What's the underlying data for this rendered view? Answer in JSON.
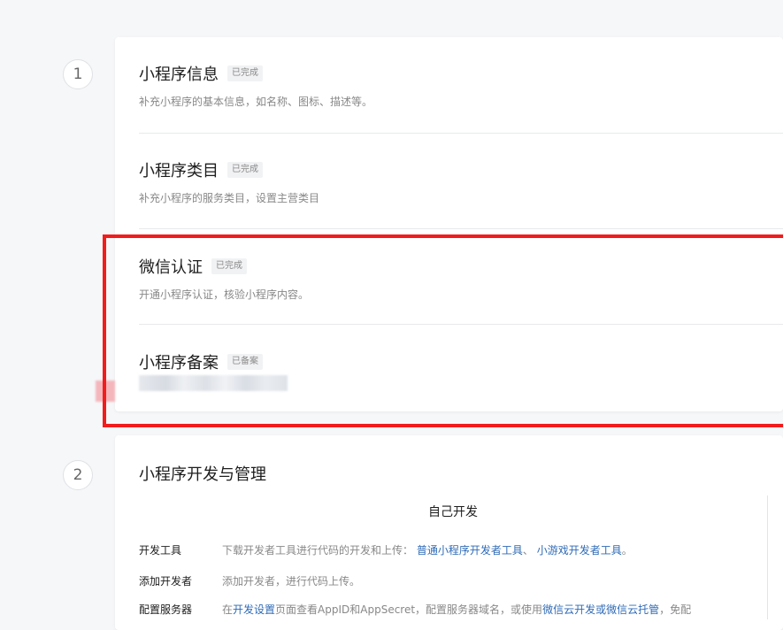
{
  "steps": [
    {
      "number": "1"
    },
    {
      "number": "2",
      "title": "小程序开发与管理"
    }
  ],
  "items": [
    {
      "title": "小程序信息",
      "badge": "已完成",
      "desc": "补充小程序的基本信息，如名称、图标、描述等。"
    },
    {
      "title": "小程序类目",
      "badge": "已完成",
      "desc": "补充小程序的服务类目，设置主营类目"
    },
    {
      "title": "微信认证",
      "badge": "已完成",
      "desc": "开通小程序认证，核验小程序内容。"
    },
    {
      "title": "小程序备案",
      "badge": "已备案"
    }
  ],
  "dev": {
    "heading": "自己开发",
    "rows": [
      {
        "label": "开发工具",
        "text": "下载开发者工具进行代码的开发和上传：",
        "link1": "普通小程序开发者工具",
        "sep": "、",
        "link2": "小游戏开发者工具",
        "end": "。"
      },
      {
        "label": "添加开发者",
        "text": "添加开发者，进行代码上传。"
      },
      {
        "label": "配置服务器",
        "pre": "在",
        "link1": "开发设置",
        "mid": "页面查看AppID和AppSecret，配置服务器域名，或使用",
        "link2": "微信云开发或微信云托管",
        "end": "，免配"
      }
    ]
  },
  "colors": {
    "highlight": "#f21c1c",
    "link": "#2f6bb6"
  }
}
